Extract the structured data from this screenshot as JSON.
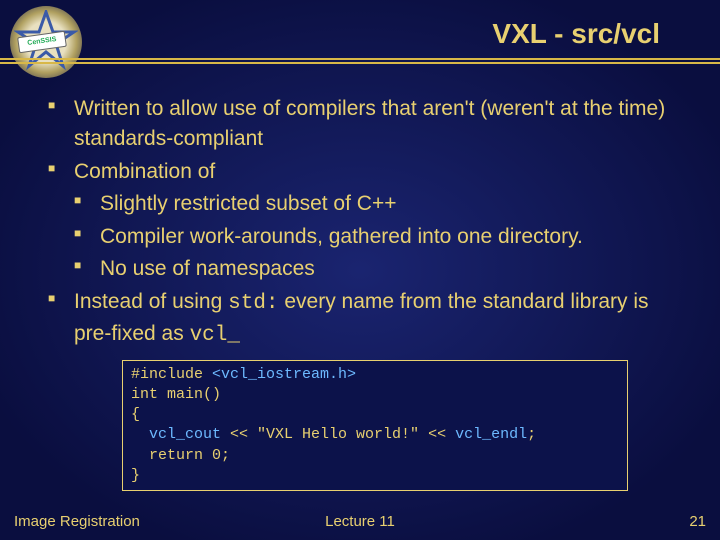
{
  "title": "VXL - src/vcl",
  "logo_badge": "CenSSIS",
  "bullets": [
    {
      "text": "Written to allow use of compilers that aren't (weren't at the time) standards-compliant"
    },
    {
      "text": "Combination of",
      "children": [
        "Slightly restricted subset of C++",
        "Compiler work-arounds, gathered into one directory.",
        "No use of namespaces"
      ]
    },
    {
      "html": "Instead of using <span class='mono'>std:</span> every name from the standard library is pre-fixed as <span class='mono'>vcl_</span>"
    }
  ],
  "code": {
    "l1a": "#include ",
    "l1b": "<vcl_iostream.h>",
    "l2": "int main()",
    "l3": "{",
    "l4a": "  ",
    "l4b": "vcl_cout",
    "l4c": " << \"VXL Hello world!\" << ",
    "l4d": "vcl_endl",
    "l4e": ";",
    "l5": "  return 0;",
    "l6": "}"
  },
  "footer": {
    "left": "Image Registration",
    "center": "Lecture 11",
    "right": "21"
  }
}
